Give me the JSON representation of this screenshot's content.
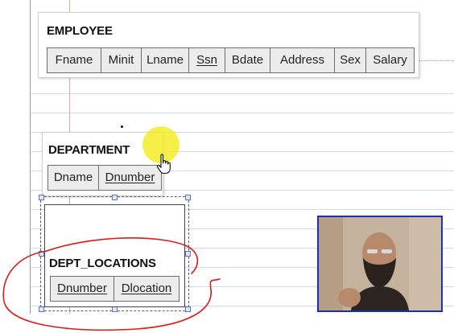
{
  "employee": {
    "title": "EMPLOYEE",
    "attributes": [
      {
        "label": "Fname",
        "key": false
      },
      {
        "label": "Minit",
        "key": false
      },
      {
        "label": "Lname",
        "key": false
      },
      {
        "label": "Ssn",
        "key": true
      },
      {
        "label": "Bdate",
        "key": false
      },
      {
        "label": "Address",
        "key": false
      },
      {
        "label": "Sex",
        "key": false
      },
      {
        "label": "Salary",
        "key": false
      }
    ]
  },
  "department": {
    "title": "DEPARTMENT",
    "attributes": [
      {
        "label": "Dname",
        "key": false
      },
      {
        "label": "Dnumber",
        "key": true
      }
    ]
  },
  "dept_locations": {
    "title": "DEPT_LOCATIONS",
    "attributes": [
      {
        "label": "Dnumber",
        "key": true
      },
      {
        "label": "Dlocation",
        "key": true
      }
    ]
  },
  "annotation": {
    "ink_color": "#e01818",
    "highlight_color": "#f5ec28"
  },
  "icons": {
    "cursor": "hand-pointer-icon"
  },
  "webcam": {
    "border_color": "#1f2fb0"
  }
}
